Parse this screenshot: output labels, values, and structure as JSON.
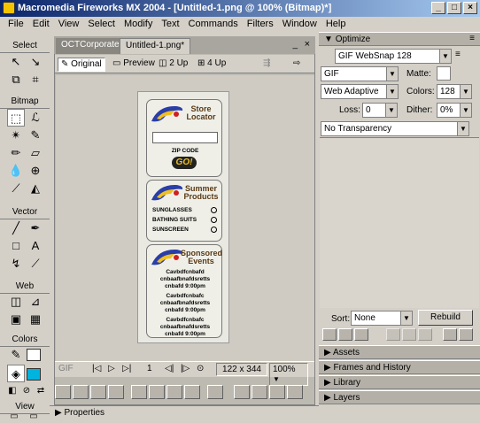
{
  "window": {
    "title": "Macromedia Fireworks MX 2004 - [Untitled-1.png @ 100% (Bitmap)*]",
    "buttons": {
      "minimize": "_",
      "restore": "□",
      "close": "×"
    }
  },
  "menu": [
    "File",
    "Edit",
    "View",
    "Select",
    "Modify",
    "Text",
    "Commands",
    "Filters",
    "Window",
    "Help"
  ],
  "tools": {
    "sections": [
      "Select",
      "Bitmap",
      "Vector",
      "Web",
      "Colors",
      "View"
    ]
  },
  "document": {
    "tabs": [
      "OCTCorporate*",
      "Untitled-1.png*"
    ],
    "view_tabs": [
      "Original",
      "Preview",
      "2 Up",
      "4 Up"
    ],
    "status": {
      "format": "GIF",
      "frame": "1",
      "dimensions": "122 x 344",
      "zoom": "100%"
    }
  },
  "artwork": {
    "store_locator": "Store Locator",
    "zip_code": "ZIP CODE",
    "go_button": "GO!",
    "summer_products": "Summer Products",
    "products": [
      "SUNGLASSES",
      "BATHING SUITS",
      "SUNSCREEN"
    ],
    "sponsored_events": "Sponsored Events",
    "events": [
      [
        "Cavbdfcnbafd",
        "cnbaafbnafdsretts",
        "cnbafd 9:00pm"
      ],
      [
        "Cavbdfcnbafc",
        "cnbaafbnafdsretts",
        "cnbafd 9:00pm"
      ],
      [
        "Cavbdfcnbafc",
        "cnbaafbnafdsretts",
        "cnbafd 9:00pm"
      ]
    ]
  },
  "properties_label": "Properties",
  "optimize": {
    "title": "Optimize",
    "preset": "GIF WebSnap 128",
    "format": "GIF",
    "matte_label": "Matte:",
    "palette": "Web Adaptive",
    "colors_label": "Colors:",
    "colors_value": "128",
    "loss_label": "Loss:",
    "loss_value": "0",
    "dither_label": "Dither:",
    "dither_value": "0%",
    "transparency": "No Transparency",
    "sort_label": "Sort:",
    "sort_value": "None",
    "rebuild_label": "Rebuild"
  },
  "panels": [
    "Assets",
    "Frames and History",
    "Library",
    "Layers"
  ]
}
